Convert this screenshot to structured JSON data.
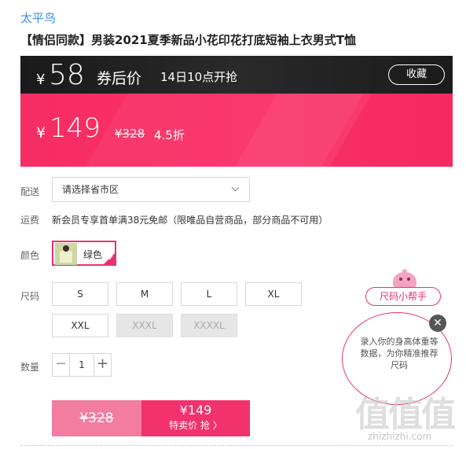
{
  "header": {
    "brand": "太平鸟",
    "title": "【情侣同款】男装2021夏季新品小花印花打底短袖上衣男式T恤"
  },
  "coupon_price": {
    "currency": "¥",
    "value": "58",
    "label": "券后价",
    "start_time": "14日10点开抢",
    "favorite_label": "收藏"
  },
  "price": {
    "currency": "¥",
    "value": "149",
    "original": "¥328",
    "discount": "4.5折"
  },
  "delivery": {
    "label": "配送",
    "placeholder": "请选择省市区"
  },
  "shipping": {
    "label": "运费",
    "text": "新会员专享首单满38元免邮（限唯品自营商品，部分商品不可用）"
  },
  "color": {
    "label": "颜色",
    "selected": "绿色"
  },
  "size": {
    "label": "尺码",
    "options": [
      "S",
      "M",
      "L",
      "XL",
      "XXL",
      "XXXL",
      "XXXXL"
    ]
  },
  "quantity": {
    "label": "数量",
    "minus": "−",
    "value": "1",
    "plus": "+"
  },
  "buy": {
    "original": "¥328",
    "price": "¥149",
    "action": "特卖价 抢 〉"
  },
  "size_helper": {
    "button": "尺码小帮手",
    "text": "录入你的身高体重等数据，为你精准推荐尺码",
    "close": "✕"
  },
  "watermark": {
    "logo": "值值值",
    "domain": "zhizhizhi.com"
  },
  "colors": {
    "accent": "#f2326d",
    "link": "#3a8ee6"
  }
}
